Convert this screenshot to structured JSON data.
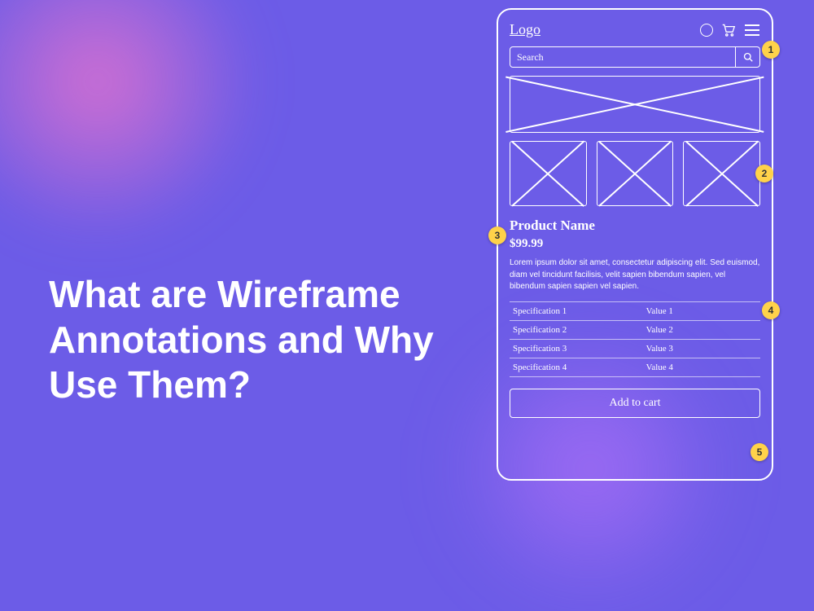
{
  "headline": "What are Wireframe Annotations and Why Use Them?",
  "wireframe": {
    "logo": "Logo",
    "search_placeholder": "Search",
    "product_name": "Product Name",
    "price": "$99.99",
    "description": "Lorem ipsum dolor sit amet, consectetur adipiscing elit. Sed euismod, diam vel tincidunt facilisis, velit sapien bibendum sapien, vel bibendum sapien sapien vel sapien.",
    "specs": [
      {
        "key": "Specification 1",
        "value": "Value 1"
      },
      {
        "key": "Specification 2",
        "value": "Value 2"
      },
      {
        "key": "Specification 3",
        "value": "Value 3"
      },
      {
        "key": "Specification 4",
        "value": "Value 4"
      }
    ],
    "cta": "Add to cart"
  },
  "annotations": {
    "1": "1",
    "2": "2",
    "3": "3",
    "4": "4",
    "5": "5"
  }
}
